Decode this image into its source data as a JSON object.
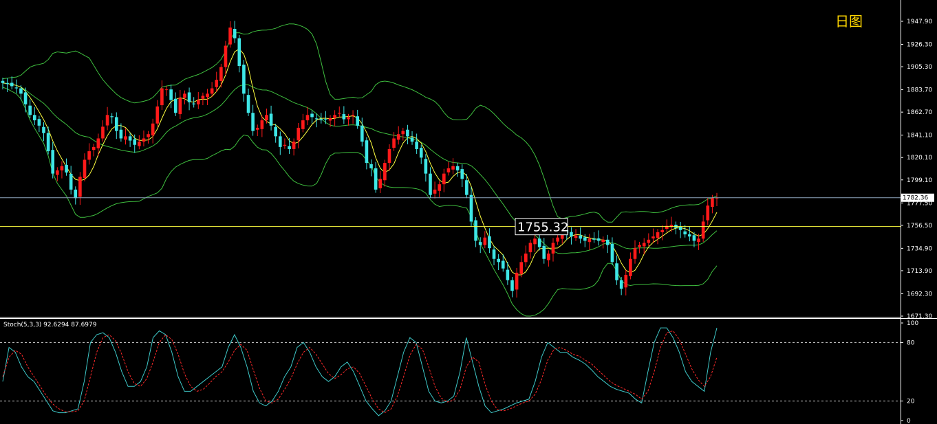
{
  "period_label": "日图",
  "colors": {
    "background": "#000000",
    "axis": "#ffffff",
    "bull": "#ff1a1a",
    "bear": "#3ee6e6",
    "bollinger": "#3fbf3f",
    "ma": "#ffff40",
    "bid_line": "#8fa7c0",
    "level_line": "#ffff40",
    "stoch_main": "#3ec8c8",
    "stoch_signal": "#ff2a2a"
  },
  "main_axis": {
    "ticks": [
      "1947.90",
      "1926.30",
      "1905.30",
      "1883.70",
      "1862.70",
      "1841.10",
      "1820.10",
      "1799.10",
      "1777.50",
      "1756.50",
      "1734.90",
      "1713.90",
      "1692.30",
      "1671.30"
    ],
    "min": 1671.3,
    "max": 1947.9
  },
  "current_price": "1782.36",
  "level_label": "1755.32",
  "indicator": {
    "title": "Stoch(5,3,3) 92.6294 87.6979",
    "ticks": [
      "100",
      "80",
      "20",
      "0"
    ],
    "levels": [
      80,
      20
    ],
    "min": 0,
    "max": 100
  },
  "chart_data": [
    {
      "type": "candlestick",
      "title": "",
      "ylim": [
        1671.3,
        1947.9
      ],
      "current_price": 1782.36,
      "horizontal_level": 1755.32,
      "close": [
        1890,
        1889,
        1887,
        1885,
        1880,
        1870,
        1860,
        1855,
        1850,
        1843,
        1826,
        1805,
        1808,
        1812,
        1806,
        1790,
        1782,
        1802,
        1818,
        1826,
        1830,
        1838,
        1849,
        1860,
        1858,
        1845,
        1838,
        1840,
        1836,
        1832,
        1835,
        1838,
        1842,
        1852,
        1868,
        1885,
        1884,
        1874,
        1862,
        1876,
        1880,
        1872,
        1870,
        1874,
        1878,
        1880,
        1885,
        1893,
        1905,
        1925,
        1942,
        1932,
        1906,
        1880,
        1862,
        1845,
        1848,
        1855,
        1860,
        1850,
        1840,
        1830,
        1832,
        1828,
        1835,
        1848,
        1855,
        1860,
        1858,
        1856,
        1855,
        1856,
        1857,
        1860,
        1862,
        1856,
        1858,
        1860,
        1850,
        1835,
        1815,
        1810,
        1790,
        1800,
        1815,
        1828,
        1838,
        1842,
        1845,
        1840,
        1835,
        1828,
        1820,
        1805,
        1785,
        1790,
        1795,
        1805,
        1810,
        1812,
        1808,
        1800,
        1785,
        1760,
        1742,
        1738,
        1745,
        1735,
        1725,
        1722,
        1716,
        1705,
        1695,
        1712,
        1722,
        1730,
        1740,
        1744,
        1736,
        1725,
        1730,
        1740,
        1745,
        1752,
        1749,
        1746,
        1747,
        1744,
        1742,
        1744,
        1743,
        1742,
        1743,
        1738,
        1722,
        1705,
        1697,
        1710,
        1725,
        1735,
        1738,
        1740,
        1743,
        1746,
        1750,
        1752,
        1756,
        1757,
        1754,
        1752,
        1748,
        1746,
        1742,
        1744,
        1760,
        1775,
        1782,
        1782.36
      ]
    },
    {
      "type": "line",
      "title": "Stoch(5,3,3)",
      "ylim": [
        0,
        100
      ],
      "series": [
        {
          "name": "",
          "values": [
            40,
            75,
            70,
            55,
            45,
            40,
            30,
            20,
            10,
            8,
            8,
            10,
            12,
            40,
            80,
            88,
            90,
            85,
            70,
            50,
            35,
            35,
            40,
            55,
            85,
            92,
            88,
            70,
            45,
            30,
            30,
            35,
            40,
            45,
            50,
            55,
            75,
            88,
            75,
            55,
            30,
            18,
            15,
            20,
            30,
            45,
            55,
            75,
            80,
            70,
            55,
            45,
            40,
            45,
            55,
            60,
            50,
            35,
            20,
            12,
            5,
            10,
            20,
            45,
            70,
            85,
            80,
            55,
            30,
            20,
            18,
            20,
            25,
            50,
            85,
            60,
            35,
            15,
            8,
            10,
            12,
            15,
            18,
            20,
            22,
            40,
            65,
            80,
            75,
            70,
            70,
            65,
            62,
            58,
            52,
            45,
            40,
            35,
            32,
            30,
            28,
            22,
            18,
            50,
            80,
            95,
            95,
            85,
            70,
            50,
            40,
            35,
            30,
            70,
            95
          ]
        },
        {
          "name": "",
          "values": [
            45,
            65,
            72,
            68,
            55,
            45,
            35,
            25,
            17,
            12,
            9,
            9,
            10,
            20,
            45,
            70,
            85,
            88,
            82,
            68,
            50,
            38,
            35,
            43,
            60,
            80,
            88,
            83,
            68,
            48,
            35,
            30,
            32,
            38,
            45,
            50,
            60,
            72,
            78,
            72,
            52,
            33,
            20,
            18,
            22,
            32,
            43,
            58,
            70,
            75,
            68,
            58,
            48,
            43,
            47,
            53,
            55,
            48,
            35,
            22,
            12,
            8,
            12,
            25,
            45,
            67,
            78,
            73,
            55,
            35,
            23,
            19,
            21,
            32,
            55,
            65,
            60,
            37,
            20,
            11,
            10,
            12,
            15,
            18,
            20,
            27,
            42,
            62,
            73,
            75,
            72,
            68,
            66,
            62,
            58,
            52,
            46,
            40,
            36,
            33,
            30,
            27,
            22,
            30,
            50,
            75,
            90,
            92,
            83,
            68,
            53,
            42,
            35,
            45,
            65
          ]
        }
      ]
    }
  ]
}
